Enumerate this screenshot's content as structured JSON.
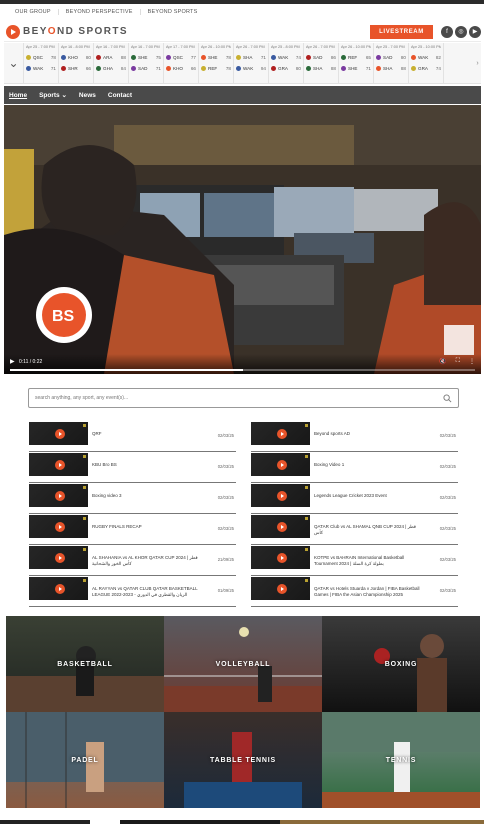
{
  "group_nav": [
    "OUR GROUP",
    "BEYOND PERSPECTIVE",
    "BEYOND SPORTS"
  ],
  "brand": {
    "name_pre": "BEY",
    "name_o": "O",
    "name_post": "ND SPORTS",
    "accent": "#e8542a"
  },
  "livestream_label": "LIVESTREAM",
  "social_icons": [
    "facebook-icon",
    "instagram-icon",
    "youtube-icon"
  ],
  "scores": [
    {
      "date": "Apr 25 - 7:00 PM",
      "home": {
        "team": "QSC",
        "score": "78"
      },
      "away": {
        "team": "WAK",
        "score": "71"
      }
    },
    {
      "date": "Apr 16 - 8:00 PM",
      "home": {
        "team": "KHO",
        "score": "80"
      },
      "away": {
        "team": "SHR",
        "score": "66"
      }
    },
    {
      "date": "Apr 16 - 7:00 PM",
      "home": {
        "team": "ARA",
        "score": "88"
      },
      "away": {
        "team": "GHA",
        "score": "84"
      }
    },
    {
      "date": "Apr 16 - 7:00 PM",
      "home": {
        "team": "SHE",
        "score": "75"
      },
      "away": {
        "team": "SAD",
        "score": "71"
      }
    },
    {
      "date": "Apr 17 - 7:00 PM",
      "home": {
        "team": "QSC",
        "score": "77"
      },
      "away": {
        "team": "KHO",
        "score": "66"
      }
    },
    {
      "date": "Apr 26 - 10:00 PM",
      "home": {
        "team": "SHE",
        "score": "78"
      },
      "away": {
        "team": "REF",
        "score": "78"
      }
    },
    {
      "date": "Apr 26 - 7:00 PM",
      "home": {
        "team": "SHA",
        "score": "71"
      },
      "away": {
        "team": "WAK",
        "score": "94"
      }
    },
    {
      "date": "Apr 25 - 8:00 PM",
      "home": {
        "team": "WAK",
        "score": "74"
      },
      "away": {
        "team": "GRA",
        "score": "80"
      }
    },
    {
      "date": "Apr 26 - 7:00 PM",
      "home": {
        "team": "SAD",
        "score": "86"
      },
      "away": {
        "team": "SHA",
        "score": "88"
      }
    },
    {
      "date": "Apr 26 - 10:00 PM",
      "home": {
        "team": "REF",
        "score": "65"
      },
      "away": {
        "team": "SHE",
        "score": "71"
      }
    },
    {
      "date": "Apr 25 - 7:00 PM",
      "home": {
        "team": "SAD",
        "score": "80"
      },
      "away": {
        "team": "SHA",
        "score": "88"
      }
    },
    {
      "date": "Apr 25 - 10:00 PM",
      "home": {
        "team": "WAK",
        "score": "82"
      },
      "away": {
        "team": "GRA",
        "score": "74"
      }
    }
  ],
  "main_nav": [
    {
      "label": "Home",
      "active": true
    },
    {
      "label": "Sports ⌄",
      "active": false
    },
    {
      "label": "News",
      "active": false
    },
    {
      "label": "Contact",
      "active": false
    }
  ],
  "video": {
    "time": "0:11 / 0:22",
    "progress": 0.5
  },
  "search": {
    "placeholder": "search anything, any sport, any event(s)..."
  },
  "videos_left": [
    {
      "title": "QRF",
      "date": "02/03/25"
    },
    {
      "title": "KBU Bro BS",
      "date": "02/03/25"
    },
    {
      "title": "Boxing video 3",
      "date": "02/03/25"
    },
    {
      "title": "RUGBY FINALS RECAP",
      "date": "02/03/25"
    },
    {
      "title": "AL SHAHANIA vs AL KHOR QATAR CUP 2024 | قطر كأس الخور والشحانية",
      "date": "21/09/25"
    },
    {
      "title": "AL RAYYAN vs QATAR CLUB QATAR BASKETBALL LEAGUE 2022-2023 - الريان والقطري في الدوري",
      "date": "01/09/25"
    }
  ],
  "videos_right": [
    {
      "title": "Beyond sports AD",
      "date": "02/03/25"
    },
    {
      "title": "Boxing Video 1",
      "date": "02/03/25"
    },
    {
      "title": "Legends League Cricket 2023 Event",
      "date": "02/03/25"
    },
    {
      "title": "QATAR Club vs AL SHAMAL QNB CUP 2024 | قطر كأس",
      "date": "02/03/25"
    },
    {
      "title": "KOTPE vs BAHRAIN International Basketball Tournament 2024 | بطولة كرة السلة",
      "date": "02/03/25"
    },
    {
      "title": "QATAR vs Hotels Stuarda v Jordan | FIBA Basketball Games | FIBA the Asian Championship 2025",
      "date": "02/03/25"
    }
  ],
  "sports": [
    "BASKETBALL",
    "VOLLEYBALL",
    "BOXING",
    "PADEL",
    "TABBLE TENNIS",
    "TENNIS"
  ]
}
